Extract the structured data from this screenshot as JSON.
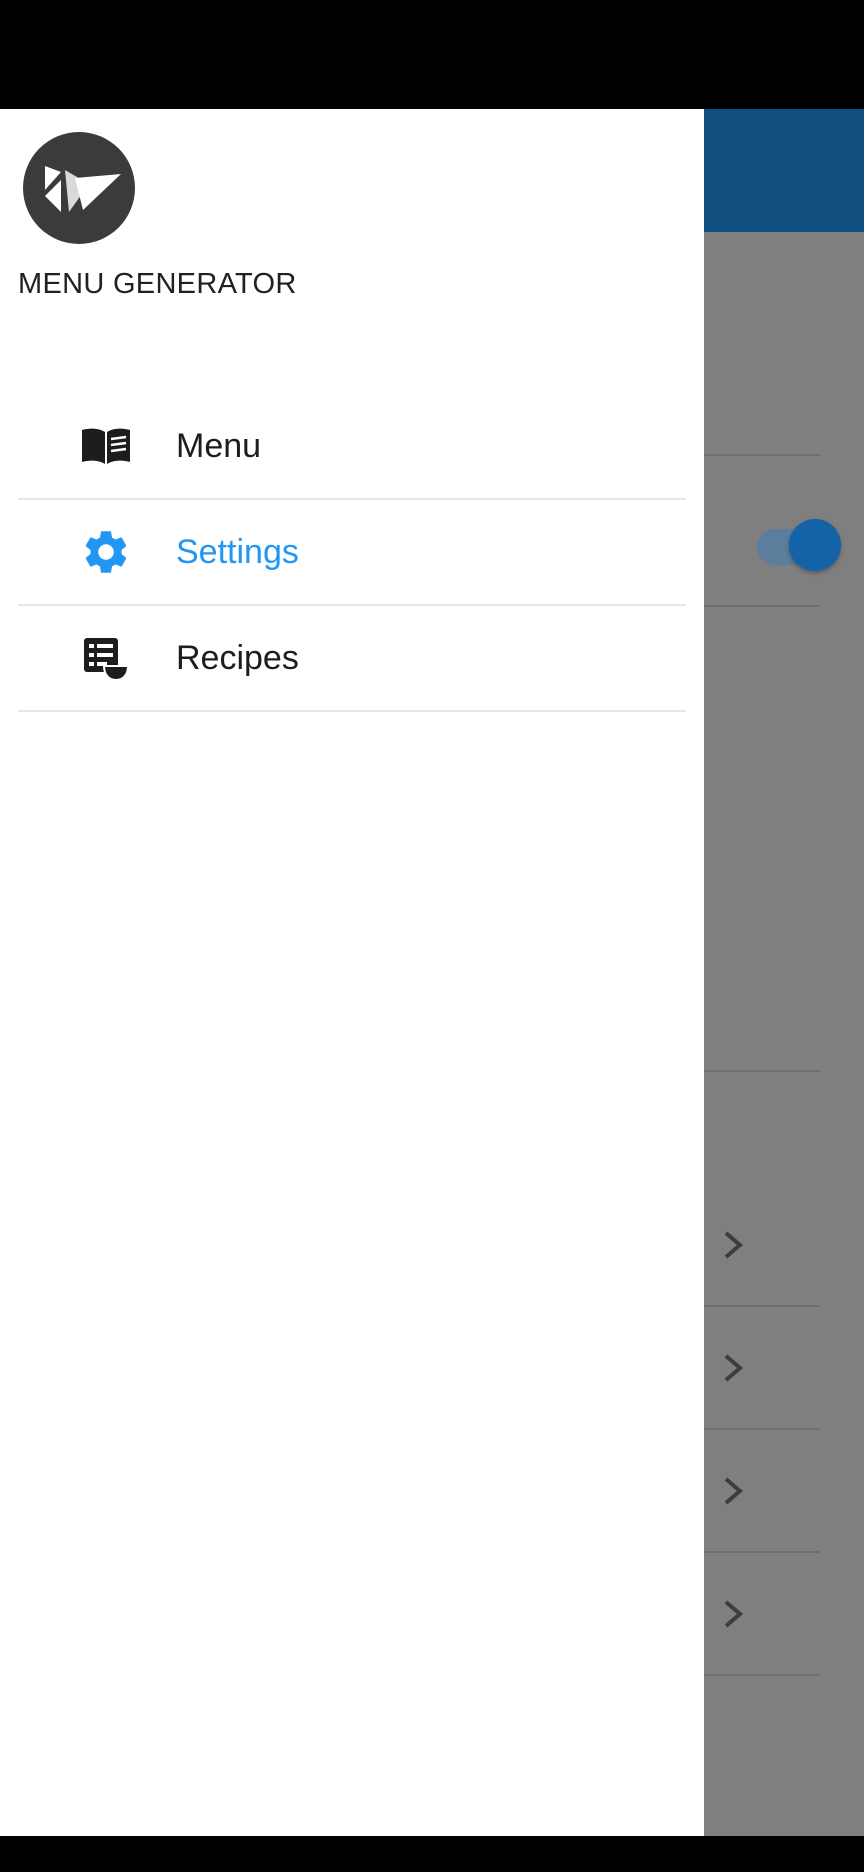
{
  "drawer": {
    "title": "MENU GENERATOR",
    "items": [
      {
        "label": "Menu",
        "icon": "book-open-icon",
        "active": false
      },
      {
        "label": "Settings",
        "icon": "gear-icon",
        "active": true
      },
      {
        "label": "Recipes",
        "icon": "recipes-icon",
        "active": false
      }
    ]
  },
  "background_app": {
    "toggle_on": true
  },
  "colors": {
    "accent": "#2196f3",
    "toolbar": "#124f7f",
    "scrim": "#7f7f7f"
  }
}
